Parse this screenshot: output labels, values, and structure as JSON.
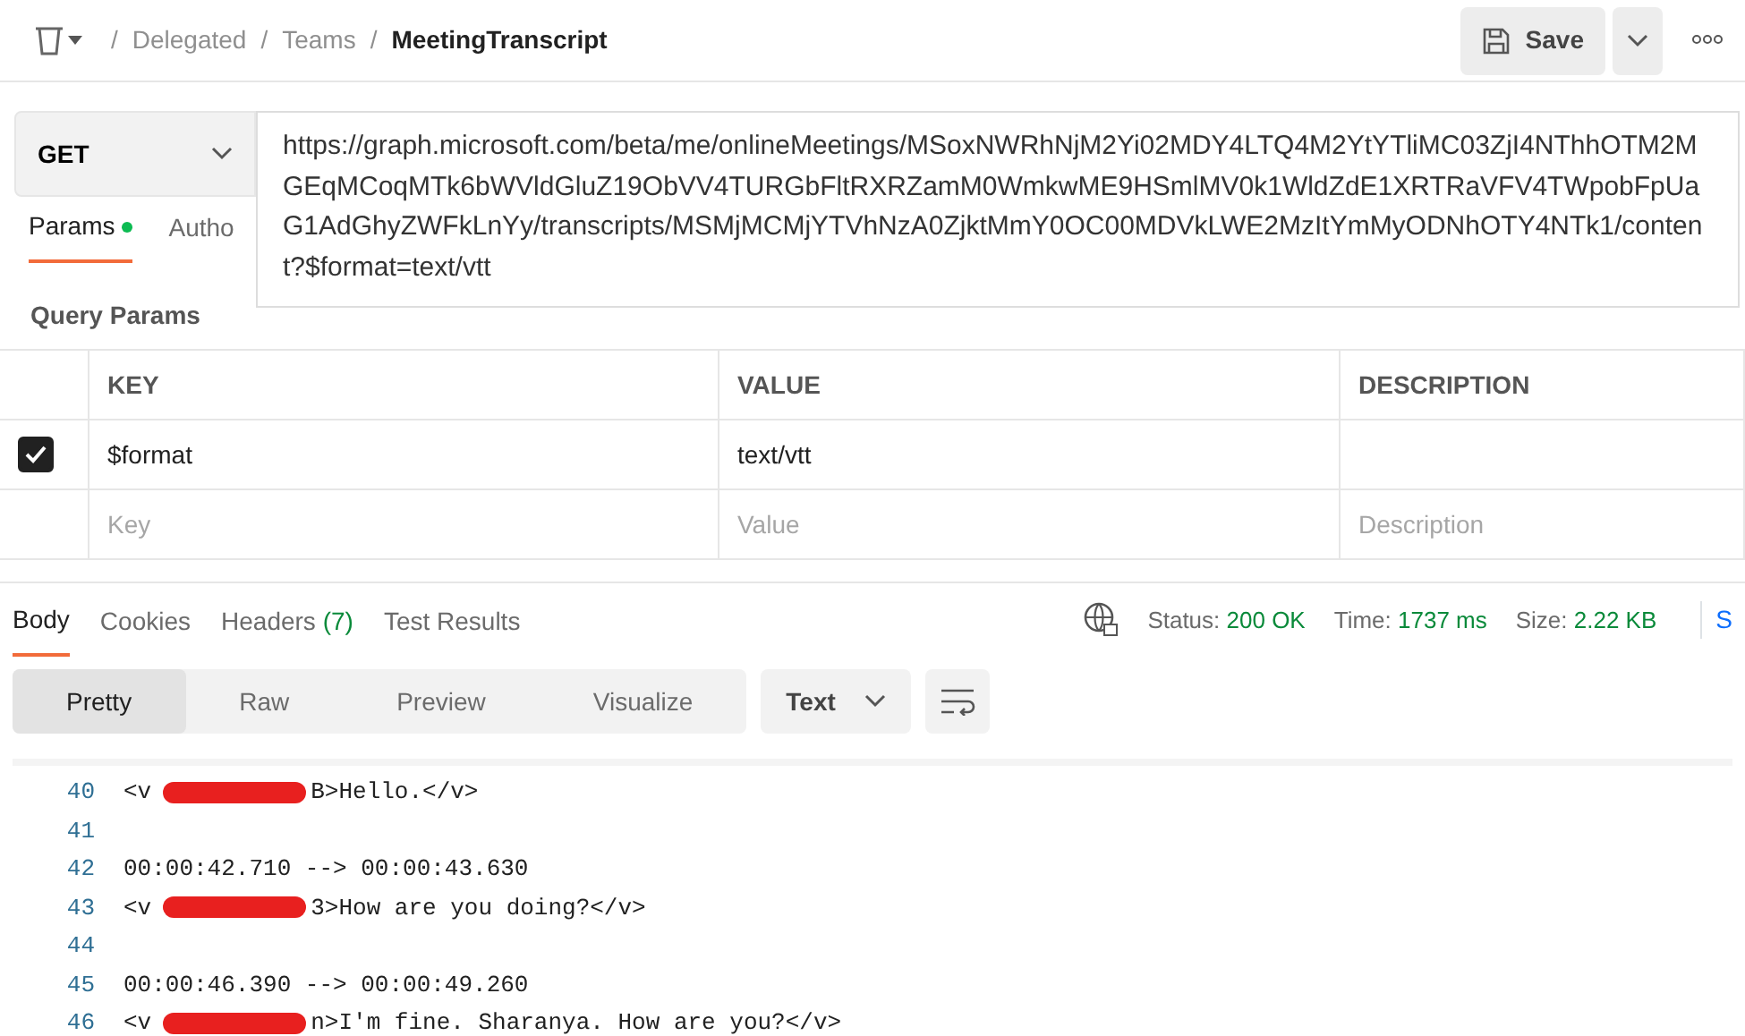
{
  "breadcrumb": {
    "separator": "/",
    "items": [
      "Delegated",
      "Teams",
      "MeetingTranscript"
    ]
  },
  "save_button": "Save",
  "request": {
    "method": "GET",
    "url": "https://graph.microsoft.com/beta/me/onlineMeetings/MSoxNWRhNjM2Yi02MDY4LTQ4M2YtYTliMC03ZjI4NThhOTM2MGEqMCoqMTk6bWVldGluZ19ObVV4TURGbFltRXRZamM0WmkwME9HSmlMV0k1WldZdE1XRTRaVFV4TWpobFpUaG1AdGhyZWFkLnYy/transcripts/MSMjMCMjYTVhNzA0ZjktMmY0OC00MDVkLWE2MzItYmMyODNhOTY4NTk1/content?$format=text/vtt"
  },
  "request_tabs": [
    {
      "label": "Params",
      "selected": true,
      "dot": true
    },
    {
      "label": "Autho",
      "selected": false,
      "dot": false
    }
  ],
  "query_params": {
    "title": "Query Params",
    "columns": [
      "KEY",
      "VALUE",
      "DESCRIPTION"
    ],
    "rows": [
      {
        "checked": true,
        "key": "$format",
        "value": "text/vtt"
      }
    ],
    "new_row": {
      "key": "Key",
      "value": "Value",
      "description": "Description"
    }
  },
  "response_tabs": [
    {
      "label": "Body",
      "selected": true
    },
    {
      "label": "Cookies",
      "selected": false
    },
    {
      "label": "Headers",
      "count": "(7)",
      "selected": false
    },
    {
      "label": "Test Results",
      "selected": false
    }
  ],
  "status": [
    {
      "label": "Status:",
      "value": "200 OK"
    },
    {
      "label": "Time:",
      "value": "1737 ms"
    },
    {
      "label": "Size:",
      "value": "2.22 KB"
    }
  ],
  "status_cut": "S",
  "view_modes": [
    {
      "label": "Pretty",
      "selected": true
    },
    {
      "label": "Raw",
      "selected": false
    },
    {
      "label": "Preview",
      "selected": false
    },
    {
      "label": "Visualize",
      "selected": false
    }
  ],
  "format_select": "Text",
  "code_lines": [
    {
      "number": "40",
      "prefix": "<v",
      "redacted": true,
      "text": "B>Hello.</v>"
    },
    {
      "number": "41"
    },
    {
      "number": "42",
      "text": "00:00:42.710 --> 00:00:43.630"
    },
    {
      "number": "43",
      "prefix": "<v",
      "redacted": true,
      "text": "3>How are you doing?</v>"
    },
    {
      "number": "44"
    },
    {
      "number": "45",
      "text": "00:00:46.390 --> 00:00:49.260"
    },
    {
      "number": "46",
      "prefix": "<v",
      "redacted": true,
      "text": "n>I'm fine. Sharanya. How are you?</v>"
    }
  ]
}
